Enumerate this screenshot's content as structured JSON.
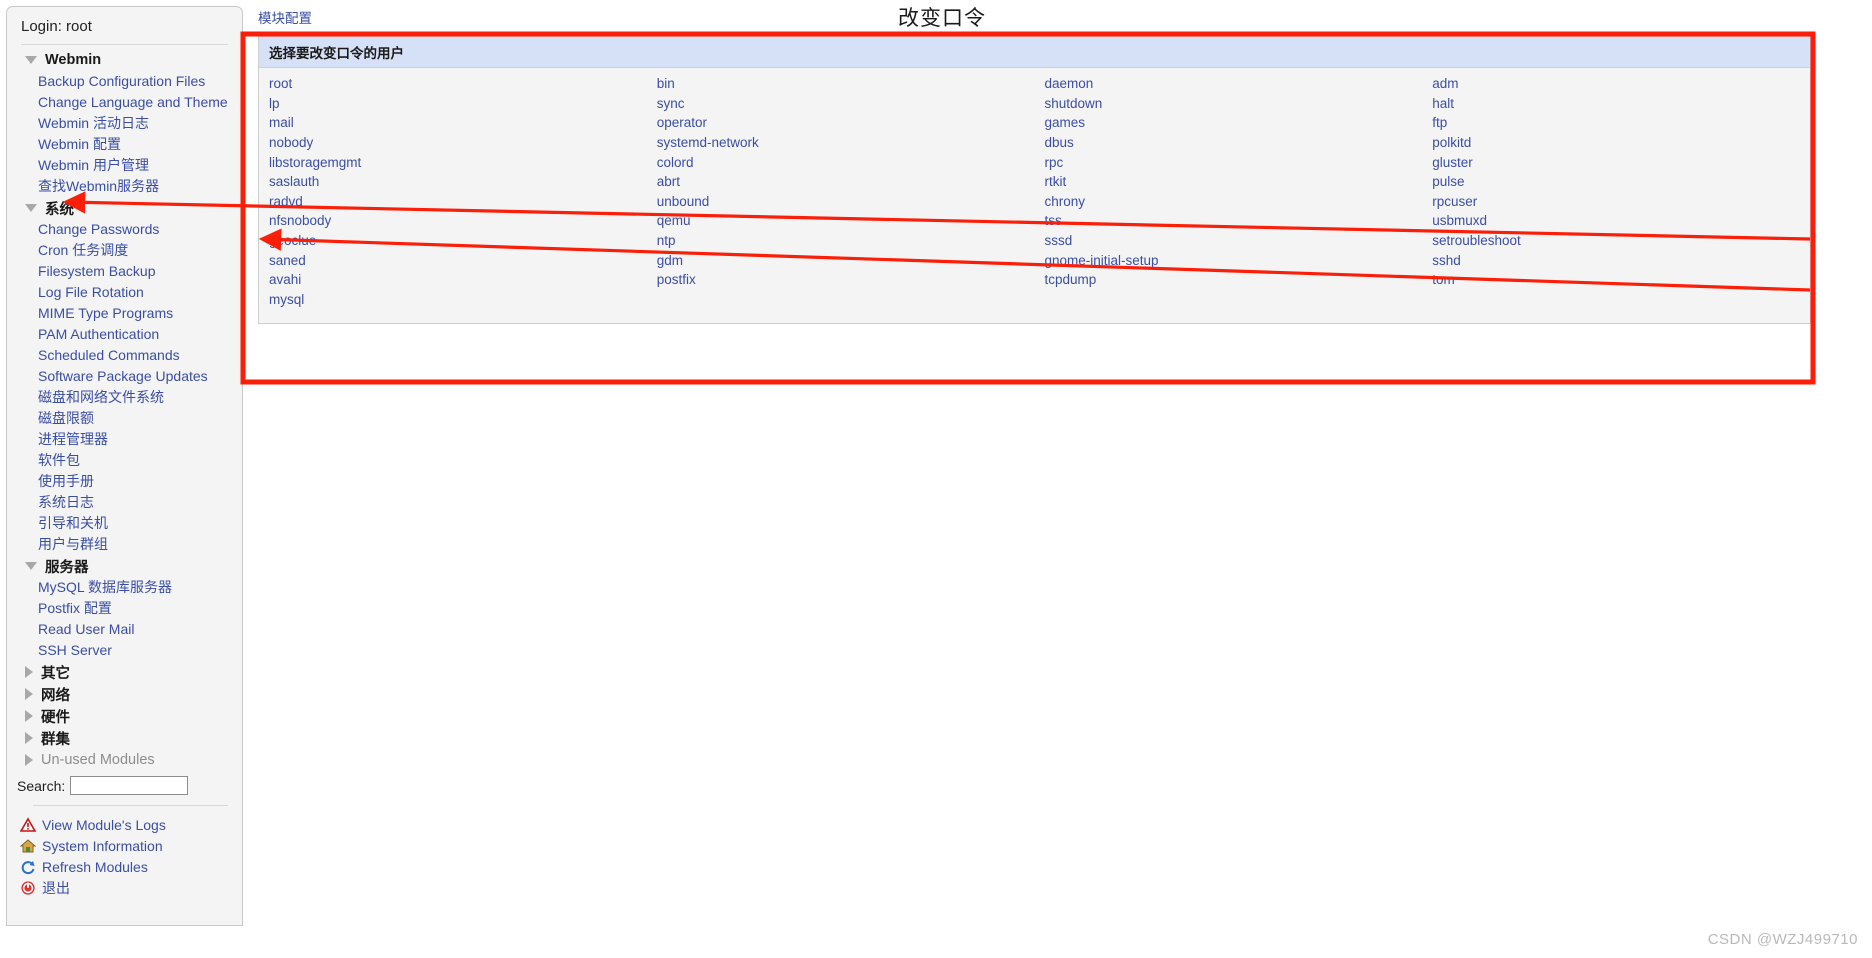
{
  "sidebar": {
    "login_label": "Login: root",
    "categories": [
      {
        "label": "Webmin",
        "expanded": true,
        "items": [
          {
            "label": "Backup Configuration Files"
          },
          {
            "label": "Change Language and Theme"
          },
          {
            "label": "Webmin 活动日志"
          },
          {
            "label": "Webmin 配置"
          },
          {
            "label": "Webmin 用户管理"
          },
          {
            "label": "查找Webmin服务器"
          }
        ]
      },
      {
        "label": "系统",
        "expanded": true,
        "items": [
          {
            "label": "Change Passwords"
          },
          {
            "label": "Cron 任务调度"
          },
          {
            "label": "Filesystem Backup"
          },
          {
            "label": "Log File Rotation"
          },
          {
            "label": "MIME Type Programs"
          },
          {
            "label": "PAM Authentication"
          },
          {
            "label": "Scheduled Commands"
          },
          {
            "label": "Software Package Updates"
          },
          {
            "label": "磁盘和网络文件系统"
          },
          {
            "label": "磁盘限额"
          },
          {
            "label": "进程管理器"
          },
          {
            "label": "软件包"
          },
          {
            "label": "使用手册"
          },
          {
            "label": "系统日志"
          },
          {
            "label": "引导和关机"
          },
          {
            "label": "用户与群组"
          }
        ]
      },
      {
        "label": "服务器",
        "expanded": true,
        "items": [
          {
            "label": "MySQL 数据库服务器"
          },
          {
            "label": "Postfix 配置"
          },
          {
            "label": "Read User Mail"
          },
          {
            "label": "SSH Server"
          }
        ]
      },
      {
        "label": "其它",
        "expanded": false,
        "items": []
      },
      {
        "label": "网络",
        "expanded": false,
        "items": []
      },
      {
        "label": "硬件",
        "expanded": false,
        "items": []
      },
      {
        "label": "群集",
        "expanded": false,
        "items": []
      },
      {
        "label": "Un-used Modules",
        "expanded": false,
        "muted": true,
        "items": []
      }
    ],
    "search": {
      "label": "Search:",
      "value": "",
      "placeholder": ""
    },
    "footer_links": [
      {
        "label": "View Module's Logs",
        "icon": "warning-triangle-icon"
      },
      {
        "label": "System Information",
        "icon": "home-icon"
      },
      {
        "label": "Refresh Modules",
        "icon": "refresh-icon"
      },
      {
        "label": "退出",
        "icon": "power-icon"
      }
    ]
  },
  "main": {
    "module_config_link": "模块配置",
    "page_title": "改变口令",
    "panel_header": "选择要改变口令的用户",
    "users": [
      [
        "root",
        "bin",
        "daemon",
        "adm"
      ],
      [
        "lp",
        "sync",
        "shutdown",
        "halt"
      ],
      [
        "mail",
        "operator",
        "games",
        "ftp"
      ],
      [
        "nobody",
        "systemd-network",
        "dbus",
        "polkitd"
      ],
      [
        "libstoragemgmt",
        "colord",
        "rpc",
        "gluster"
      ],
      [
        "saslauth",
        "abrt",
        "rtkit",
        "pulse"
      ],
      [
        "radvd",
        "unbound",
        "chrony",
        "rpcuser"
      ],
      [
        "nfsnobody",
        "qemu",
        "tss",
        "usbmuxd"
      ],
      [
        "geoclue",
        "ntp",
        "sssd",
        "setroubleshoot"
      ],
      [
        "saned",
        "gdm",
        "gnome-initial-setup",
        "sshd"
      ],
      [
        "avahi",
        "postfix",
        "tcpdump",
        "tom"
      ],
      [
        "mysql",
        "",
        "",
        ""
      ]
    ]
  },
  "watermark": "CSDN @WZJ499710",
  "colors": {
    "accent_link": "#3a4ea8",
    "panel_header_bg": "#d6e1f7",
    "panel_bg": "#f4f4f4",
    "annotation_red": "#fb1e08",
    "sidebar_bg": "#f4f4f4"
  }
}
